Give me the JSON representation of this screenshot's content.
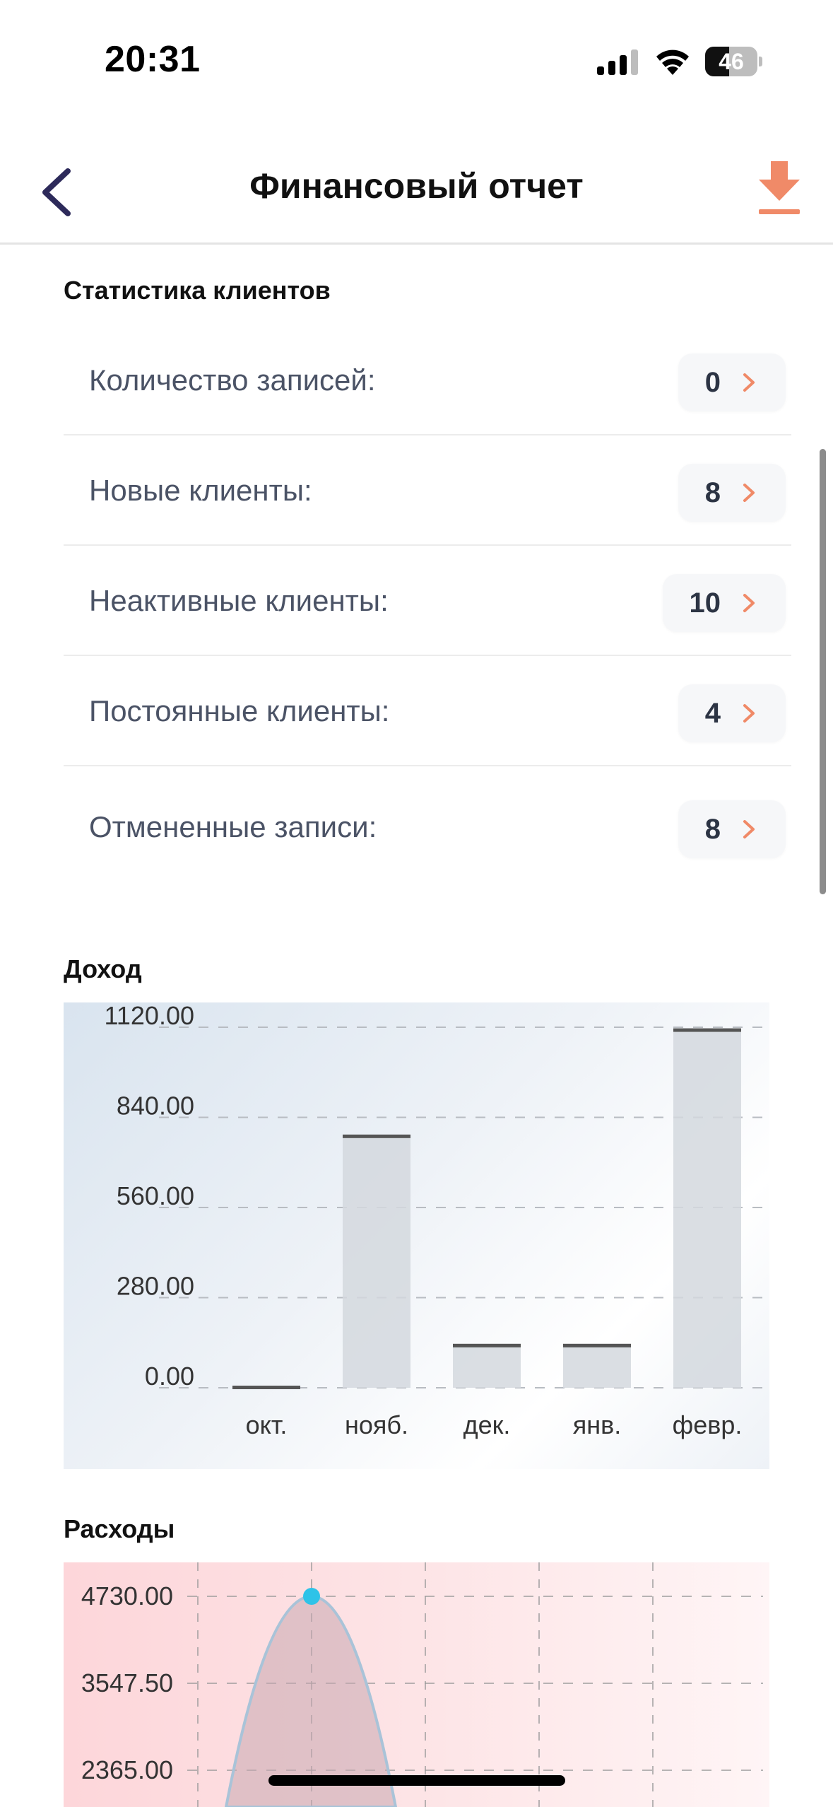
{
  "status_bar": {
    "time": "20:31",
    "battery": "46",
    "battery_level": 0.46,
    "icons": [
      "signal-icon",
      "wifi-icon",
      "battery-icon"
    ]
  },
  "nav": {
    "title": "Финансовый отчет",
    "back_icon": "chevron-left-icon",
    "download_icon": "download-icon"
  },
  "colors": {
    "accent": "#f08a68",
    "back": "#2d2a5a",
    "label": "#4b5366",
    "value": "#2c3444",
    "bar": "#d3d8de",
    "bar_cap": "#555555",
    "expense_line": "#a9c3d8",
    "expense_point": "#2ec3e8"
  },
  "stats": {
    "title": "Статистика клиентов",
    "items": [
      {
        "label": "Количество записей:",
        "value": "0"
      },
      {
        "label": "Новые клиенты:",
        "value": "8"
      },
      {
        "label": "Неактивные клиенты:",
        "value": "10"
      },
      {
        "label": "Постоянные клиенты:",
        "value": "4"
      },
      {
        "label": "Отмененные записи:",
        "value": "8"
      }
    ]
  },
  "income": {
    "title": "Доход"
  },
  "expenses": {
    "title": "Расходы"
  },
  "chart_data": [
    {
      "type": "bar",
      "title": "Доход",
      "categories": [
        "окт.",
        "нояб.",
        "дек.",
        "янв.",
        "февр."
      ],
      "values": [
        0,
        780,
        130,
        130,
        1110
      ],
      "y_ticks": [
        "0.00",
        "280.00",
        "560.00",
        "840.00",
        "1120.00"
      ],
      "ylim": [
        0,
        1120
      ],
      "grid": true
    },
    {
      "type": "area",
      "title": "Расходы",
      "x": [
        "",
        "",
        "",
        "",
        ""
      ],
      "values": [
        0,
        4730,
        0,
        0,
        0
      ],
      "y_ticks": [
        "2365.00",
        "3547.50",
        "4730.00"
      ],
      "ylim": [
        0,
        4730
      ],
      "grid": true
    }
  ]
}
